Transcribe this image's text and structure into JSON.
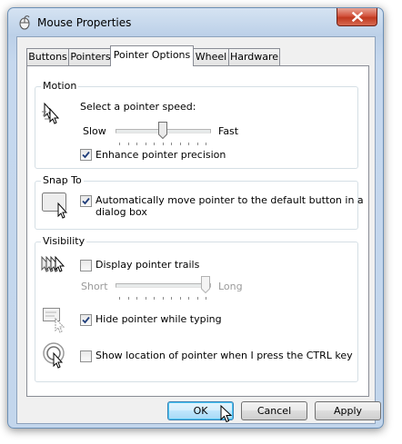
{
  "window": {
    "title": "Mouse Properties"
  },
  "tabs": [
    {
      "label": "Buttons"
    },
    {
      "label": "Pointers"
    },
    {
      "label": "Pointer Options"
    },
    {
      "label": "Wheel"
    },
    {
      "label": "Hardware"
    }
  ],
  "motion": {
    "label": "Motion",
    "speed_prompt": "Select a pointer speed:",
    "slow": "Slow",
    "fast": "Fast",
    "speed_level": 0.5,
    "enhance_label": "Enhance pointer precision",
    "enhance_checked": true
  },
  "snap_to": {
    "label": "Snap To",
    "auto_move_line1": "Automatically move pointer to the default button in a",
    "auto_move_line2": "dialog box",
    "auto_move_checked": true
  },
  "visibility": {
    "label": "Visibility",
    "trails_label": "Display pointer trails",
    "trails_checked": false,
    "short": "Short",
    "long": "Long",
    "trails_level": 1.0,
    "hide_label": "Hide pointer while typing",
    "hide_checked": true,
    "ctrl_label": "Show location of pointer when I press the CTRL key",
    "ctrl_checked": false
  },
  "buttons": {
    "ok": "OK",
    "cancel": "Cancel",
    "apply": "Apply"
  }
}
